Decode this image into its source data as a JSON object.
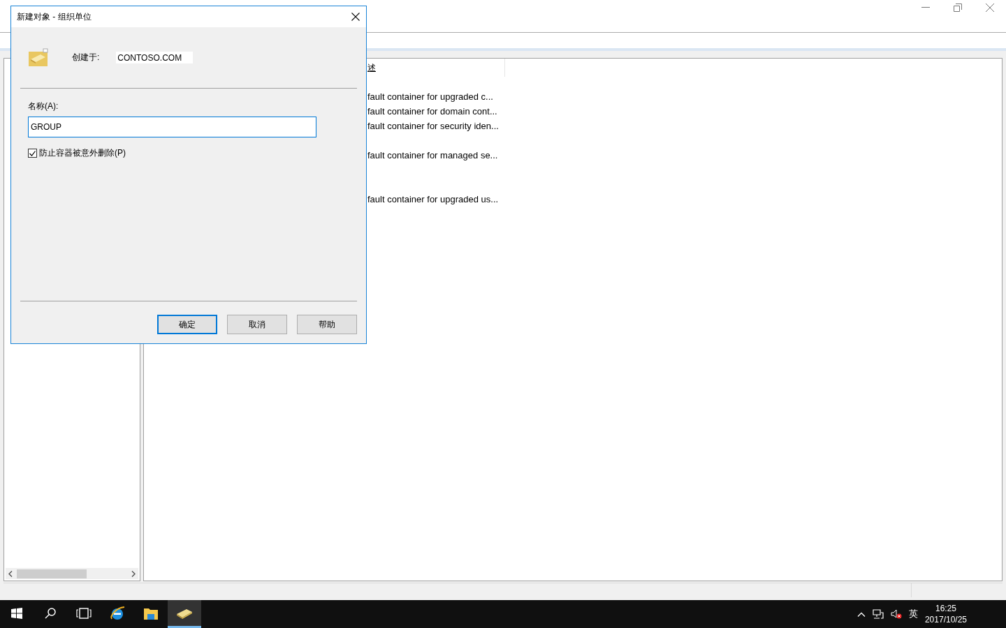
{
  "list": {
    "header": "述",
    "rows": [
      {
        "description": "fault container for upgraded c..."
      },
      {
        "description": "fault container for domain cont..."
      },
      {
        "description": "fault container for security iden..."
      },
      {},
      {
        "description": "fault container for managed se..."
      },
      {},
      {},
      {
        "description": "fault container for upgraded us..."
      }
    ]
  },
  "dialog": {
    "title": "新建对象 - 组织单位",
    "created_in_label": "创建于:",
    "created_in_value": "CONTOSO.COM",
    "name_label": "名称(A):",
    "name_value": "GROUP",
    "protect": {
      "label": "防止容器被意外删除(P)",
      "checked": true
    },
    "buttons": [
      {
        "label": "确定",
        "default": true
      },
      {
        "label": "取消",
        "default": false
      },
      {
        "label": "帮助",
        "default": false
      }
    ]
  },
  "taskbar": {
    "apps": [
      {
        "kind": "search",
        "selected": false
      },
      {
        "kind": "taskview",
        "selected": false
      },
      {
        "kind": "browser",
        "selected": false
      },
      {
        "kind": "folder",
        "selected": false
      },
      {
        "kind": "directory",
        "selected": true
      }
    ],
    "language": "英",
    "time": "16:25",
    "date": "2017/10/25"
  }
}
